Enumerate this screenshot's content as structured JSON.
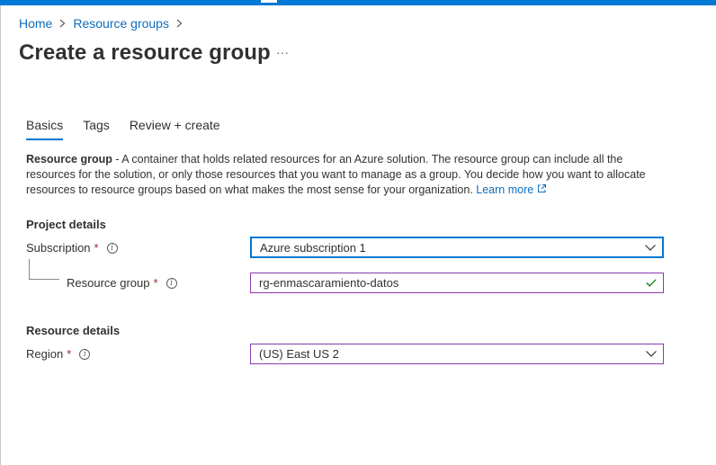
{
  "breadcrumb": {
    "items": [
      "Home",
      "Resource groups"
    ]
  },
  "page": {
    "title": "Create a resource group",
    "more_label": "···"
  },
  "tabs": [
    {
      "label": "Basics",
      "active": true
    },
    {
      "label": "Tags",
      "active": false
    },
    {
      "label": "Review + create",
      "active": false
    }
  ],
  "description": {
    "bold": "Resource group",
    "text": " - A container that holds related resources for an Azure solution. The resource group can include all the resources for the solution, or only those resources that you want to manage as a group. You decide how you want to allocate resources to resource groups based on what makes the most sense for your organization.",
    "link": "Learn more"
  },
  "project_details": {
    "title": "Project details",
    "subscription": {
      "label": "Subscription",
      "required": "*",
      "value": "Azure subscription 1"
    },
    "resource_group": {
      "label": "Resource group",
      "required": "*",
      "value": "rg-enmascaramiento-datos"
    }
  },
  "resource_details": {
    "title": "Resource details",
    "region": {
      "label": "Region",
      "required": "*",
      "value": "(US) East US 2"
    }
  },
  "icons": {
    "info": "i",
    "chevron": "chevron-down-icon",
    "check": "checkmark-icon",
    "external": "external-link-icon"
  },
  "colors": {
    "accent": "#0078d4",
    "link": "#0f6cbd",
    "required": "#a4262c",
    "valid": "#107c10",
    "field_border": "#8a3bab"
  }
}
